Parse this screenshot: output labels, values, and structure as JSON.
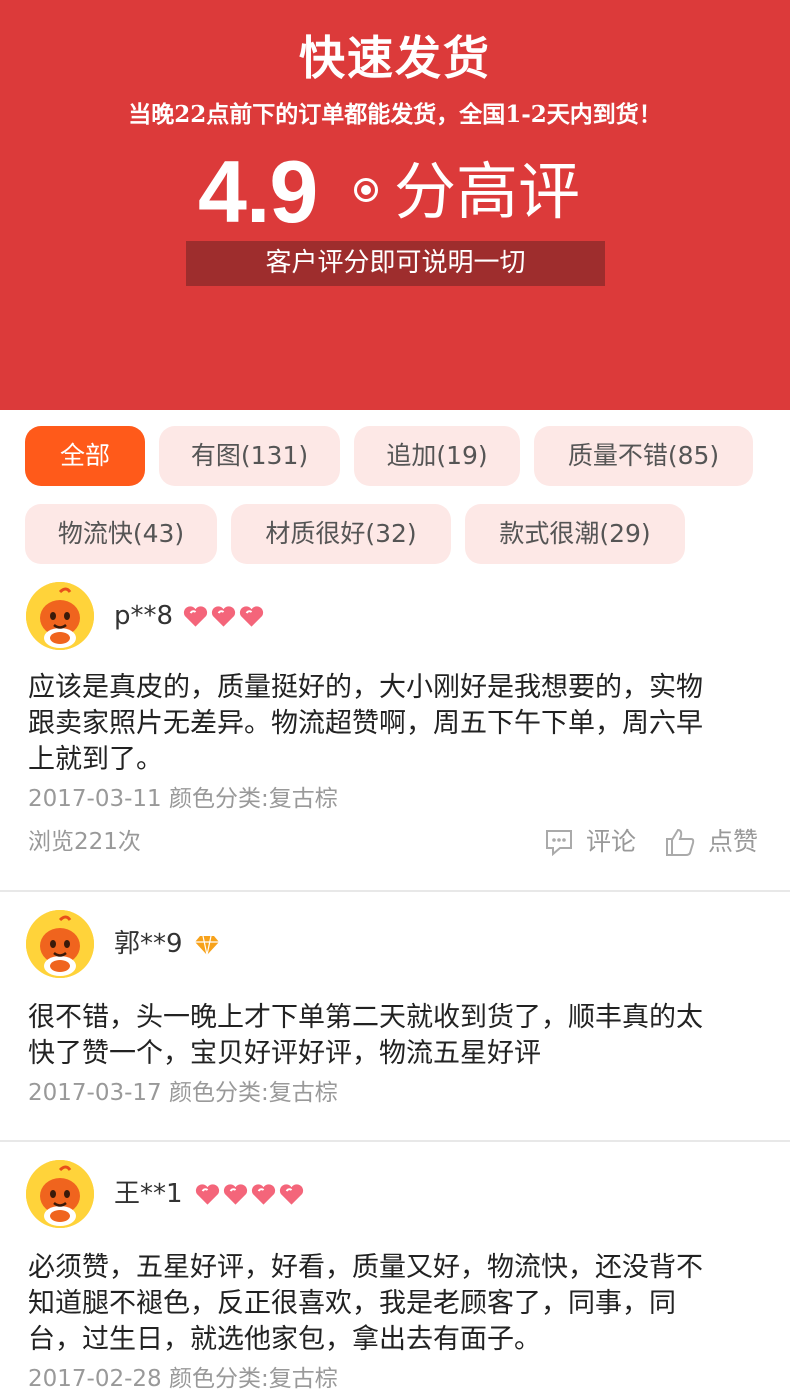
{
  "banner": {
    "title": "快速发货",
    "subtitle": "当晚22点前下的订单都能发货，全国1-2天内到货！",
    "rating_value": "4.9",
    "rating_suffix": "分高评",
    "note": "客户评分即可说明一切",
    "colors": {
      "background": "#dc3a3a",
      "note_background": "#9e2d2d"
    }
  },
  "filters": {
    "tags": [
      {
        "label": "全部",
        "active": true
      },
      {
        "label": "有图(131)",
        "active": false
      },
      {
        "label": "追加(19)",
        "active": false
      },
      {
        "label": "质量不错(85)",
        "active": false
      },
      {
        "label": "物流快(43)",
        "active": false
      },
      {
        "label": "材质很好(32)",
        "active": false
      },
      {
        "label": "款式很潮(29)",
        "active": false
      }
    ],
    "colors": {
      "active": "#ff5a1a",
      "inactive": "#fde8e6"
    }
  },
  "reviews": [
    {
      "user": "p**8",
      "badge_icon": "heart-badge-icon",
      "badge_count": 3,
      "text_lines": [
        "应该是真皮的，质量挺好的，大小刚好是我想要的，实物",
        "跟卖家照片无差异。物流超赞啊，周五下午下单，周六早",
        "上就到了。"
      ],
      "meta": "2017-03-11 颜色分类:复古棕",
      "views": "浏览221次",
      "comment_label": "评论",
      "like_label": "点赞"
    },
    {
      "user": "郭**9",
      "badge_icon": "diamond-badge-icon",
      "badge_count": 1,
      "text_lines": [
        "很不错，头一晚上才下单第二天就收到货了，顺丰真的太",
        "快了赞一个，宝贝好评好评，物流五星好评"
      ],
      "meta": "2017-03-17 颜色分类:复古棕"
    },
    {
      "user": "王**1",
      "badge_icon": "heart-badge-icon",
      "badge_count": 4,
      "text_lines": [
        "必须赞，五星好评，好看，质量又好，物流快，还没背不",
        "知道腿不褪色，反正很喜欢，我是老顾客了，同事，同",
        "台，过生日，就选他家包，拿出去有面子。"
      ],
      "meta": "2017-02-28 颜色分类:复古棕"
    }
  ]
}
